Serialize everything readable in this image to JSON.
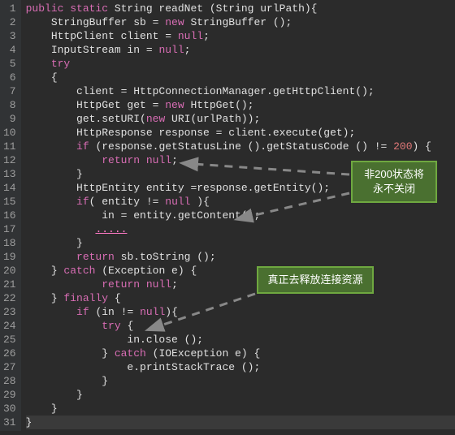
{
  "gutter": [
    "1",
    "2",
    "3",
    "4",
    "5",
    "6",
    "7",
    "8",
    "9",
    "10",
    "11",
    "12",
    "13",
    "14",
    "15",
    "16",
    "17",
    "18",
    "19",
    "20",
    "21",
    "22",
    "23",
    "24",
    "25",
    "26",
    "27",
    "28",
    "29",
    "30",
    "31"
  ],
  "code": {
    "l1": {
      "a": "public static ",
      "b": "String readNet (String urlPath){"
    },
    "l2": {
      "a": "    StringBuffer sb = ",
      "b": "new",
      "c": " StringBuffer ();"
    },
    "l3": {
      "a": "    HttpClient client = ",
      "b": "null",
      "c": ";"
    },
    "l4": {
      "a": "    InputStream in = ",
      "b": "null",
      "c": ";"
    },
    "l5": {
      "a": "    ",
      "b": "try"
    },
    "l6": "    {",
    "l7": "        client = HttpConnectionManager.getHttpClient();",
    "l8": {
      "a": "        HttpGet get = ",
      "b": "new",
      "c": " HttpGet();"
    },
    "l9": {
      "a": "        get.setURI(",
      "b": "new",
      "c": " URI(urlPath));"
    },
    "l10": "        HttpResponse response = client.execute(get);",
    "l11": {
      "a": "        ",
      "b": "if",
      "c": " (response.getStatusLine ().getStatusCode () != ",
      "d": "200",
      "e": ") {"
    },
    "l12": {
      "a": "            ",
      "b": "return null",
      "c": ";"
    },
    "l13": "        }",
    "l14": "        HttpEntity entity =response.getEntity();",
    "l15": {
      "a": "        ",
      "b": "if",
      "c": "( entity != ",
      "d": "null",
      "e": " ){"
    },
    "l16": "            in = entity.getContent();",
    "l17": {
      "a": "           ",
      "b": ".....",
      "c": ""
    },
    "l18": "        }",
    "l19": {
      "a": "        ",
      "b": "return",
      "c": " sb.toString ();"
    },
    "l20": {
      "a": "    } ",
      "b": "catch",
      "c": " (Exception e) {"
    },
    "l21": {
      "a": "            ",
      "b": "return null",
      "c": ";"
    },
    "l22": {
      "a": "    } ",
      "b": "finally",
      "c": " {"
    },
    "l23": {
      "a": "        ",
      "b": "if",
      "c": " (in != ",
      "d": "null",
      "e": "){"
    },
    "l24": {
      "a": "            ",
      "b": "try",
      "c": " {"
    },
    "l25": "                in.close ();",
    "l26": {
      "a": "            } ",
      "b": "catch",
      "c": " (IOException e) {"
    },
    "l27": "                e.printStackTrace ();",
    "l28": "            }",
    "l29": "        }",
    "l30": "    }",
    "l31": "}"
  },
  "callouts": {
    "c1": "非200状态将永不关闭",
    "c2": "真正去释放连接资源"
  }
}
